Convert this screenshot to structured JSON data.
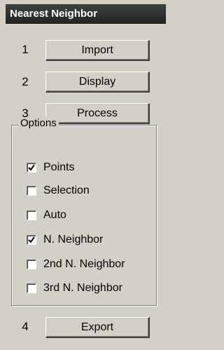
{
  "panel": {
    "title": "Nearest Neighbor"
  },
  "steps": [
    {
      "number": "1",
      "label": "Import"
    },
    {
      "number": "2",
      "label": "Display"
    },
    {
      "number": "3",
      "label": "Process"
    }
  ],
  "options": {
    "group_label": "Options",
    "items": [
      {
        "label": "Points",
        "checked": true
      },
      {
        "label": "Selection",
        "checked": false
      },
      {
        "label": "Auto",
        "checked": false
      },
      {
        "label": "N. Neighbor",
        "checked": true
      },
      {
        "label": "2nd N. Neighbor",
        "checked": false
      },
      {
        "label": "3rd N. Neighbor",
        "checked": false
      }
    ]
  },
  "export_step": {
    "number": "4",
    "label": "Export"
  },
  "icons": {
    "checkmark": "checkmark-icon"
  }
}
